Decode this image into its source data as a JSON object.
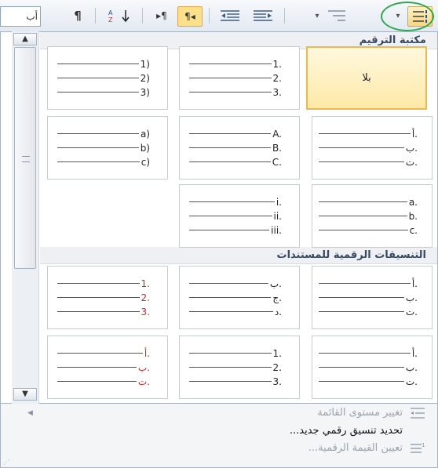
{
  "toolbar": {
    "prev_field_text": "أب",
    "show_marks_glyph": "¶",
    "sort_glyph": "↓",
    "ltr_glyph": "▸¶",
    "rtl_glyph": "¶◂"
  },
  "sections": [
    {
      "title": "مكتبة الترقيم"
    },
    {
      "title": "التنسيقات الرقمية للمستندات"
    }
  ],
  "tiles": {
    "none_label": "بلا",
    "num_dot": [
      "1.",
      "2.",
      "3."
    ],
    "num_paren": [
      "1)",
      "2)",
      "3)"
    ],
    "arabic_letters": [
      "أ.",
      "ب.",
      "ت."
    ],
    "upper_alpha": [
      "A.",
      "B.",
      "C."
    ],
    "lower_paren": [
      "a)",
      "b)",
      "c)"
    ],
    "lower_alpha": [
      "a.",
      "b.",
      "c."
    ],
    "lower_roman": [
      "i.",
      "ii.",
      "iii."
    ],
    "doc_arabic_letters": [
      "أ.",
      "ب.",
      "ت."
    ],
    "doc_abjad": [
      "ب.",
      "ج.",
      "د."
    ],
    "doc_num_red": [
      "1.",
      "2.",
      "3."
    ],
    "doc_arabic_letters_2": [
      "أ.",
      "ب.",
      "ت."
    ],
    "doc_num_dot": [
      "1.",
      "2.",
      "3."
    ],
    "doc_arabic_red": [
      "أ.",
      "ب.",
      "ت."
    ]
  },
  "menu": {
    "change_level": "تغيير مستوى القائمة",
    "define_new": "تحديد تنسيق رقمي جديد...",
    "set_value": "تعيين القيمة الرقمية..."
  },
  "colors": {
    "accent_red": "#e02020",
    "selected_fill": "#fde9a6",
    "highlight_circle": "#2ea84f"
  }
}
